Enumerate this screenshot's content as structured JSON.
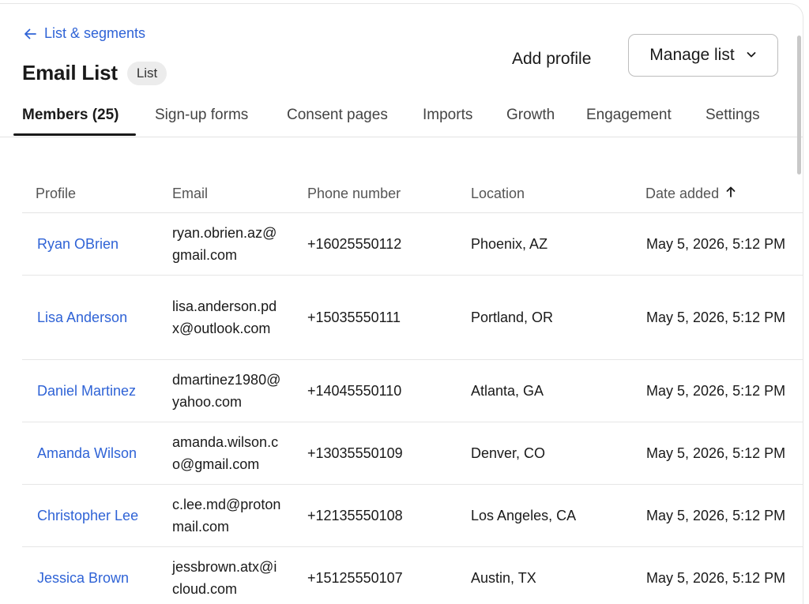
{
  "header": {
    "back_label": "List & segments",
    "title": "Email List",
    "type_badge": "List",
    "add_profile_label": "Add profile",
    "manage_list_label": "Manage list"
  },
  "tabs": [
    {
      "label": "Members (25)",
      "active": true
    },
    {
      "label": "Sign-up forms"
    },
    {
      "label": "Consent pages"
    },
    {
      "label": "Imports"
    },
    {
      "label": "Growth"
    },
    {
      "label": "Engagement"
    },
    {
      "label": "Settings"
    }
  ],
  "table": {
    "columns": [
      "Profile",
      "Email",
      "Phone number",
      "Location",
      "Date added"
    ],
    "sorted_column": "Date added",
    "sort_direction": "ascending",
    "rows": [
      {
        "profile": "Ryan OBrien",
        "email": "ryan.obrien.az@gmail.com",
        "phone": "+16025550112",
        "location": "Phoenix, AZ",
        "date_added": "May 5, 2026, 5:12 PM"
      },
      {
        "profile": "Lisa Anderson",
        "email": "lisa.anderson.pdx@outlook.com",
        "phone": "+15035550111",
        "location": "Portland, OR",
        "date_added": "May 5, 2026, 5:12 PM"
      },
      {
        "profile": "Daniel Martinez",
        "email": "dmartinez1980@yahoo.com",
        "phone": "+14045550110",
        "location": "Atlanta, GA",
        "date_added": "May 5, 2026, 5:12 PM"
      },
      {
        "profile": "Amanda Wilson",
        "email": "amanda.wilson.co@gmail.com",
        "phone": "+13035550109",
        "location": "Denver, CO",
        "date_added": "May 5, 2026, 5:12 PM"
      },
      {
        "profile": "Christopher Lee",
        "email": "c.lee.md@protonmail.com",
        "phone": "+12135550108",
        "location": "Los Angeles, CA",
        "date_added": "May 5, 2026, 5:12 PM"
      },
      {
        "profile": "Jessica Brown",
        "email": "jessbrown.atx@icloud.com",
        "phone": "+15125550107",
        "location": "Austin, TX",
        "date_added": "May 5, 2026, 5:12 PM"
      }
    ]
  },
  "icons": {
    "back": "arrow-left-icon",
    "manage_menu": "chevron-down-icon",
    "sort": "arrow-up-icon"
  },
  "colors": {
    "link": "#2f63d6",
    "text": "#1a1a1a",
    "muted": "#555555",
    "border": "#e3e3e3",
    "badge_bg": "#ececec"
  }
}
